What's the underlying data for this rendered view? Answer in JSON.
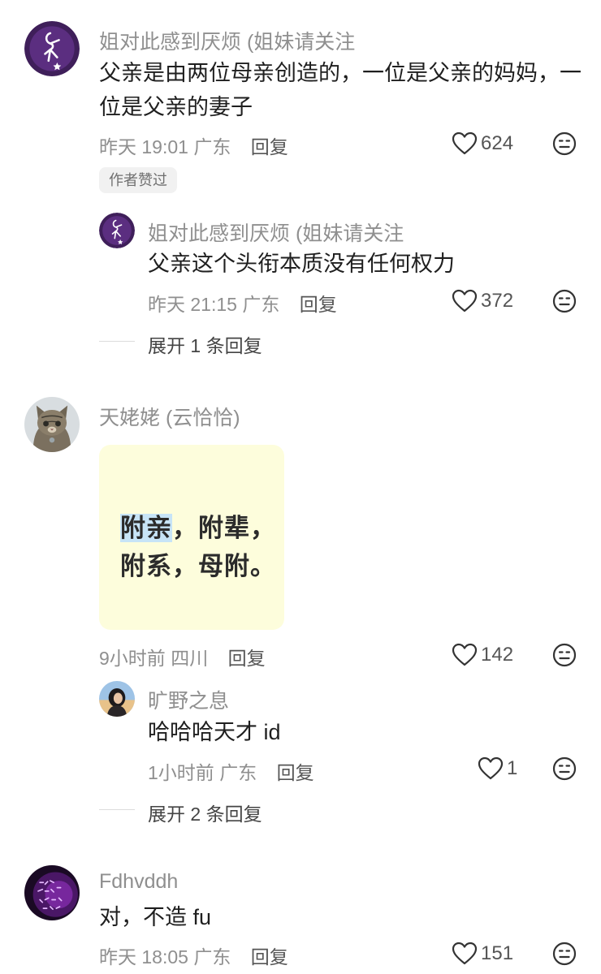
{
  "comments": [
    {
      "username": "姐对此感到厌烦 (姐妹请关注",
      "text_lines": [
        "父亲是由两位母亲创造的，一位是父亲的妈妈，一",
        "位是父亲的妻子"
      ],
      "time": "昨天 19:01",
      "location": "广东",
      "reply_label": "回复",
      "likes": "624",
      "badge": "作者赞过",
      "avatar_icon": "purple-star-figure-avatar",
      "replies": [
        {
          "username": "姐对此感到厌烦 (姐妹请关注",
          "text": "父亲这个头衔本质没有任何权力",
          "time": "昨天 21:15",
          "location": "广东",
          "reply_label": "回复",
          "likes": "372"
        }
      ],
      "expand_label": "展开 1 条回复"
    },
    {
      "username": "天姥姥 (云恰恰)",
      "sticker": {
        "line1_highlight": "附亲",
        "line1_rest": "，附辈，",
        "line2": "附系，母附。",
        "background": "#fdfddc"
      },
      "time": "9小时前",
      "location": "四川",
      "reply_label": "回复",
      "likes": "142",
      "avatar_icon": "cat-avatar",
      "replies": [
        {
          "username": "旷野之息",
          "text": "哈哈哈天才 id",
          "time": "1小时前",
          "location": "广东",
          "reply_label": "回复",
          "likes": "1"
        }
      ],
      "expand_label": "展开 2 条回复"
    },
    {
      "username": "Fdhvddh",
      "text": "对，不造 fu",
      "time": "昨天 18:05",
      "location": "广东",
      "reply_label": "回复",
      "likes": "151",
      "avatar_icon": "purple-text-avatar"
    }
  ],
  "icons": {
    "like": "heart-outline-icon",
    "dislike": "neutral-face-icon"
  },
  "colors": {
    "secondary_text": "#8f8f8f",
    "primary_text": "#1f1f1f",
    "badge_bg": "#f1f1f1",
    "highlight": "#c7e4f7"
  }
}
